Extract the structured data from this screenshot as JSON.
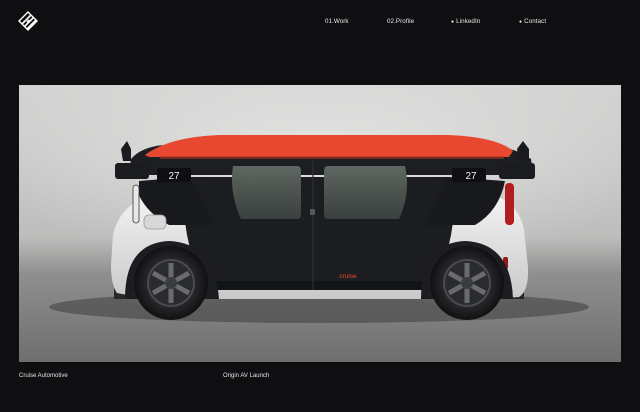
{
  "header": {
    "logo_icon": "striped-diamond-logo-icon",
    "nav": [
      {
        "label": "01.Work",
        "bullet": ""
      },
      {
        "label": "02.Profile",
        "bullet": ""
      },
      {
        "label": "LinkedIn",
        "bullet": "●"
      },
      {
        "label": "Contact",
        "bullet": "●"
      }
    ]
  },
  "hero": {
    "image": "cruise-origin-autonomous-vehicle-photo",
    "vehicle_brand": "cruise",
    "door_number": "27"
  },
  "captions": {
    "client": "Cruise Automotive",
    "project": "Origin AV Launch"
  },
  "colors": {
    "page_background": "#0f0f12",
    "roof_accent": "#e8482f",
    "text": "#e9e9ea"
  }
}
